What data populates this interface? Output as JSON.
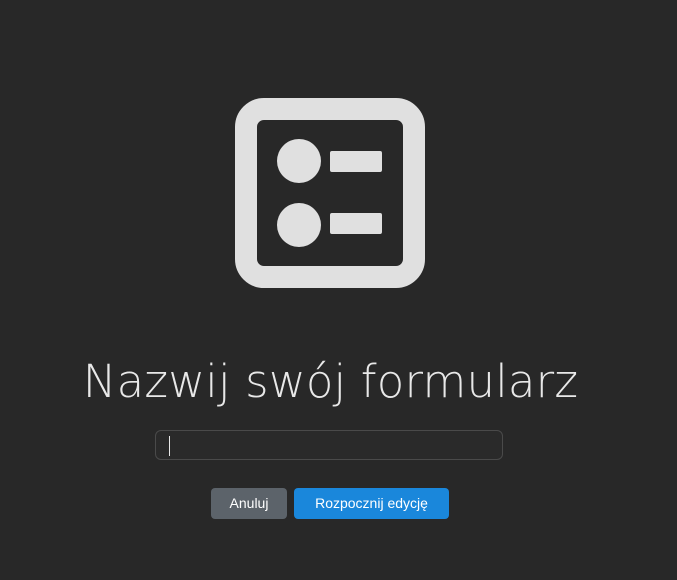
{
  "dialog": {
    "title": "Nazwij swój formularz",
    "name_input": {
      "value": "",
      "placeholder": ""
    },
    "cancel_label": "Anuluj",
    "start_label": "Rozpocznij edycję"
  },
  "icons": {
    "header": "form-list-icon"
  },
  "colors": {
    "background": "#282828",
    "icon": "#e0e0e0",
    "primary_button": "#1a87db",
    "secondary_button": "#5c636a"
  }
}
